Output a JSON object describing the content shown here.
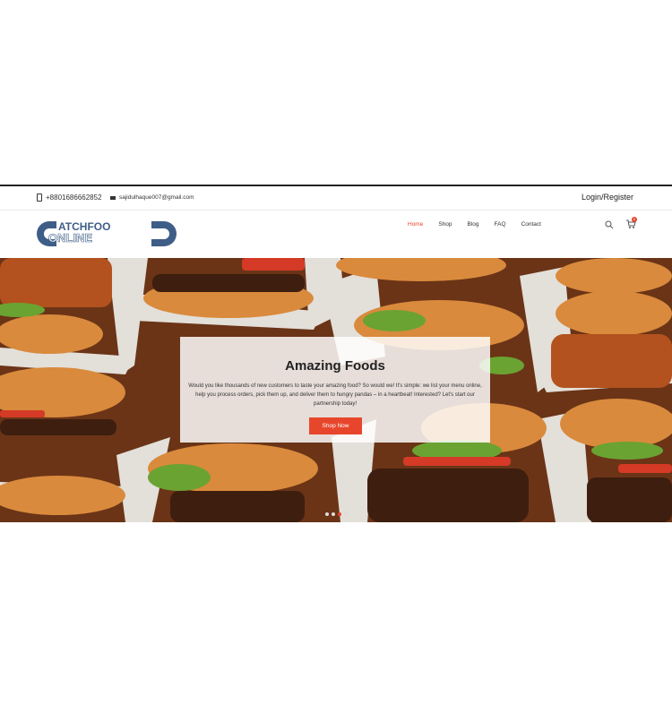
{
  "topbar": {
    "phone": "+8801686662852",
    "email": "sajidulhaque007@gmail.com",
    "login": "Login/Register"
  },
  "logo": {
    "line1": "ATCHFOO",
    "line2": "ONLINE",
    "letter_c": "C",
    "letter_d": "D"
  },
  "nav": {
    "items": [
      "Home",
      "Shop",
      "Blog",
      "FAQ",
      "Contact"
    ],
    "active": "Home"
  },
  "cart": {
    "count": "0"
  },
  "hero": {
    "title": "Amazing Foods",
    "text": "Would you like thousands of new customers to taste your amazing food? So would we! It's simple: we list your menu online, help you process orders, pick them up, and deliver them to hungry pandas – in a heartbeat! Interested? Let's start our partnership today!",
    "button": "Shop Now",
    "slides": 4,
    "active_slide": 2
  },
  "colors": {
    "accent": "#e8462c",
    "logo_blue": "#3f5e87"
  }
}
